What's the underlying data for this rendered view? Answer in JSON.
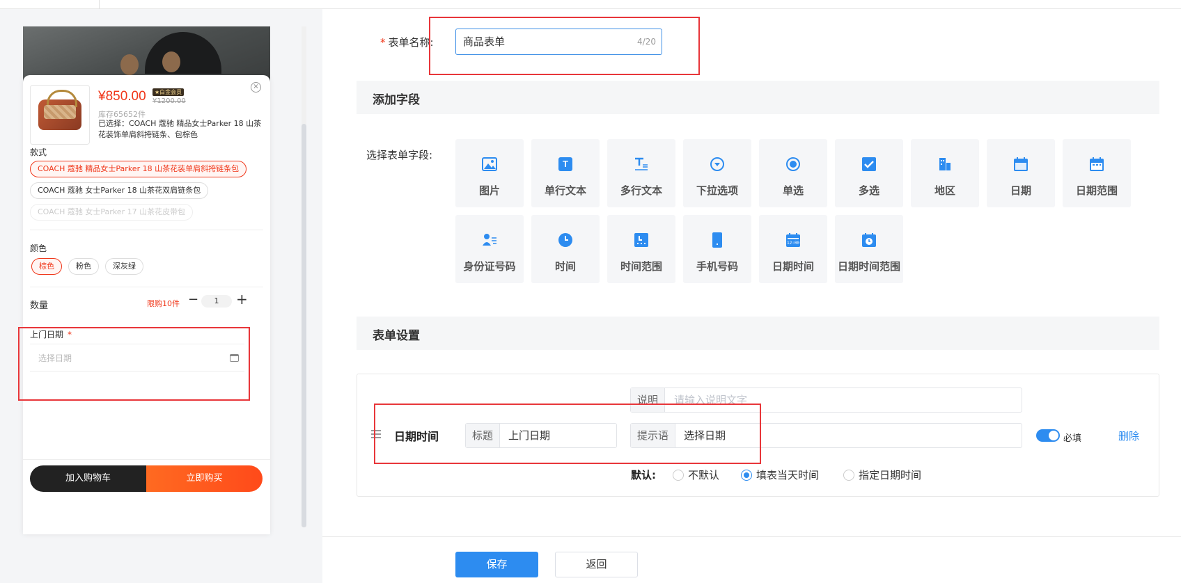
{
  "preview": {
    "price": "¥850.00",
    "vip_tag": "★白金会员",
    "old_price": "¥1200.00",
    "stock": "库存65652件",
    "selected": "已选择：COACH 蔻驰 精品女士Parker 18 山茶花装饰单肩斜挎链条、包棕色",
    "style_label": "款式",
    "styles": [
      "COACH 蔻驰 精品女士Parker 18 山茶花装单肩斜挎链条包",
      "COACH 蔻驰 女士Parker 18 山茶花双肩链条包",
      "COACH 蔻驰 女士Parker 17 山茶花皮带包"
    ],
    "color_label": "颜色",
    "colors": [
      "棕色",
      "粉色",
      "深灰绿"
    ],
    "qty_label": "数量",
    "limit": "限购10件",
    "minus": "−",
    "qty": "1",
    "plus": "+",
    "date_label": "上门日期",
    "date_star": "*",
    "date_placeholder": "选择日期",
    "add_cart": "加入购物车",
    "buy_now": "立即购买",
    "close": "×"
  },
  "form": {
    "name_label": "表单名称:",
    "name_req": "*",
    "name_value": "商品表单",
    "name_counter": "4/20",
    "add_field_title": "添加字段",
    "select_fields_label": "选择表单字段:",
    "fields": [
      {
        "label": "图片",
        "icon": "image-icon"
      },
      {
        "label": "单行文本",
        "icon": "text-t-icon"
      },
      {
        "label": "多行文本",
        "icon": "multiline-text-icon"
      },
      {
        "label": "下拉选项",
        "icon": "dropdown-icon"
      },
      {
        "label": "单选",
        "icon": "radio-icon"
      },
      {
        "label": "多选",
        "icon": "checkbox-icon"
      },
      {
        "label": "地区",
        "icon": "building-icon"
      },
      {
        "label": "日期",
        "icon": "calendar-icon"
      },
      {
        "label": "日期范围",
        "icon": "calendar-range-icon"
      },
      {
        "label": "身份证号码",
        "icon": "id-card-icon"
      },
      {
        "label": "时间",
        "icon": "clock-icon"
      },
      {
        "label": "时间范围",
        "icon": "time-range-icon"
      },
      {
        "label": "手机号码",
        "icon": "phone-icon"
      },
      {
        "label": "日期时间",
        "icon": "datetime-icon"
      },
      {
        "label": "日期时间范围",
        "icon": "datetime-range-icon"
      }
    ],
    "settings_title": "表单设置",
    "row": {
      "type": "日期时间",
      "title_addon": "标题",
      "title_value": "上门日期",
      "desc_addon": "说明",
      "desc_placeholder": "请输入说明文字",
      "hint_addon": "提示语",
      "hint_value": "选择日期",
      "required_label": "必填",
      "required": true,
      "delete": "删除",
      "default_label": "默认:",
      "defaults": [
        "不默认",
        "填表当天时间",
        "指定日期时间"
      ],
      "default_selected": 1
    },
    "save": "保存",
    "back": "返回"
  },
  "colors": {
    "accent": "#2d8cf0",
    "price_red": "#f0371a",
    "highlight_box": "#e8363a"
  }
}
